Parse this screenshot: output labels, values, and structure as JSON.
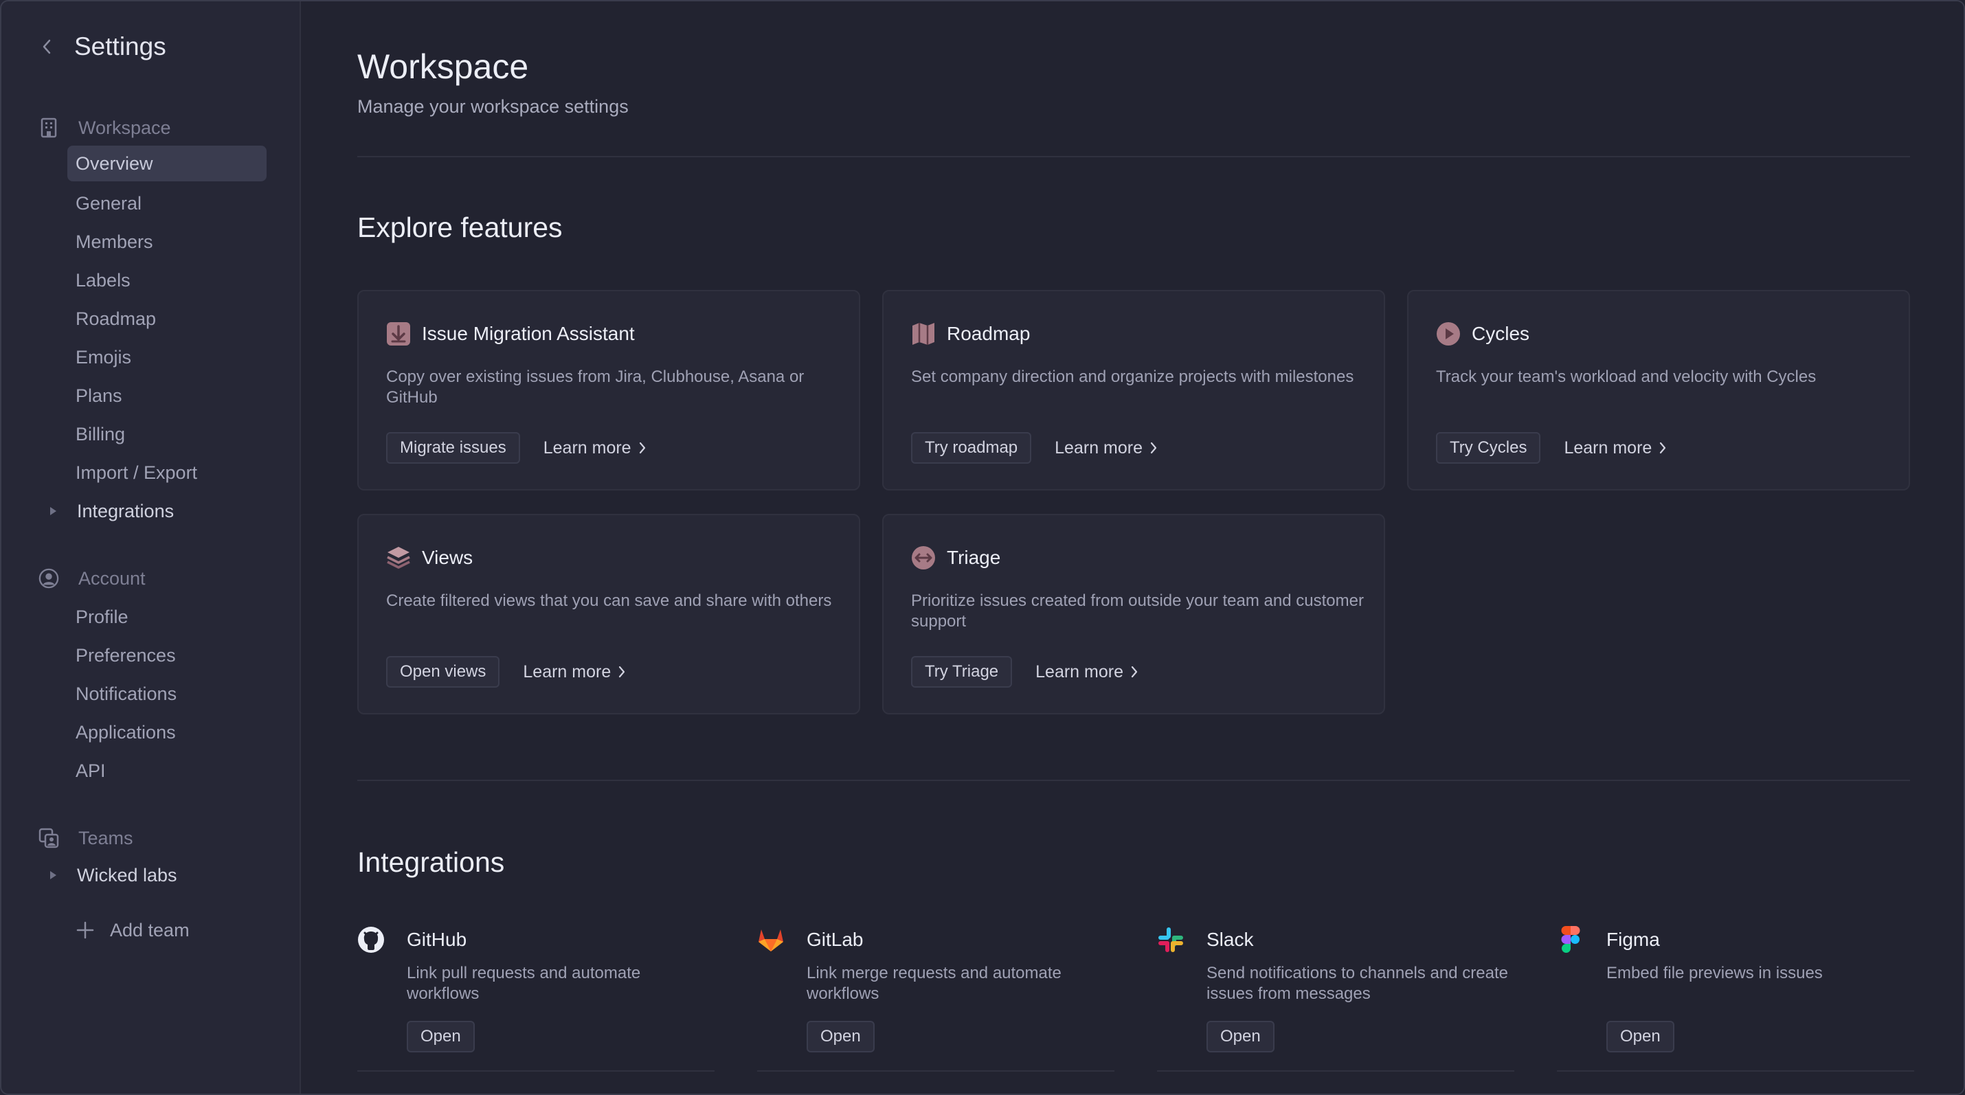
{
  "sidebar": {
    "title": "Settings",
    "workspace": {
      "label": "Workspace",
      "items": [
        "Overview",
        "General",
        "Members",
        "Labels",
        "Roadmap",
        "Emojis",
        "Plans",
        "Billing",
        "Import / Export"
      ],
      "active": "Overview",
      "group": "Integrations"
    },
    "account": {
      "label": "Account",
      "items": [
        "Profile",
        "Preferences",
        "Notifications",
        "Applications",
        "API"
      ]
    },
    "teams": {
      "label": "Teams",
      "team": "Wicked labs",
      "add": "Add team"
    }
  },
  "header": {
    "title": "Workspace",
    "subtitle": "Manage your workspace settings"
  },
  "explore": {
    "title": "Explore features",
    "cards": [
      {
        "icon": "migration-icon",
        "title": "Issue Migration Assistant",
        "desc": "Copy over existing issues from Jira, Clubhouse, Asana or GitHub",
        "button": "Migrate issues",
        "link": "Learn more"
      },
      {
        "icon": "roadmap-map-icon",
        "title": "Roadmap",
        "desc": "Set company direction and organize projects with milestones",
        "button": "Try roadmap",
        "link": "Learn more"
      },
      {
        "icon": "cycles-play-icon",
        "title": "Cycles",
        "desc": "Track your team's workload and velocity with Cycles",
        "button": "Try Cycles",
        "link": "Learn more"
      },
      {
        "icon": "views-layers-icon",
        "title": "Views",
        "desc": "Create filtered views that you can save and share with others",
        "button": "Open views",
        "link": "Learn more"
      },
      {
        "icon": "triage-icon",
        "title": "Triage",
        "desc": "Prioritize issues created from outside your team and customer support",
        "button": "Try Triage",
        "link": "Learn more"
      }
    ]
  },
  "integrations": {
    "title": "Integrations",
    "items": [
      {
        "icon": "github-icon",
        "title": "GitHub",
        "desc": "Link pull requests and automate workflows",
        "button": "Open"
      },
      {
        "icon": "gitlab-icon",
        "title": "GitLab",
        "desc": "Link merge requests and automate workflows",
        "button": "Open"
      },
      {
        "icon": "slack-icon",
        "title": "Slack",
        "desc": "Send notifications to channels and create issues from messages",
        "button": "Open"
      },
      {
        "icon": "figma-icon",
        "title": "Figma",
        "desc": "Embed file previews in issues",
        "button": "Open"
      }
    ]
  },
  "colors": {
    "background": "#222330",
    "sidebar": "#262736",
    "card": "#272836",
    "accent_icon": "#a77b86"
  }
}
